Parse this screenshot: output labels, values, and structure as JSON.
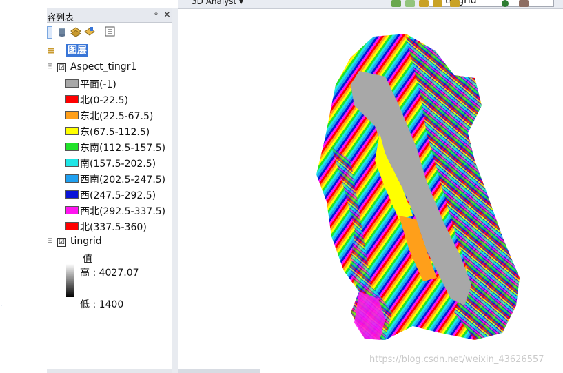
{
  "toolbar": {
    "analyst_label": "3D Analyst ▾",
    "layer_combo_value": "tingrid"
  },
  "toc": {
    "title": "容列表",
    "pin": "ᵠ",
    "close": "×",
    "root_label": "图层",
    "layers": [
      {
        "name": "Aspect_tingr1",
        "checked": "☑",
        "classes": [
          {
            "label": "平面(-1)",
            "color": "#a8a8a8"
          },
          {
            "label": "北(0-22.5)",
            "color": "#ff0000"
          },
          {
            "label": "东北(22.5-67.5)",
            "color": "#ff9f1a"
          },
          {
            "label": "东(67.5-112.5)",
            "color": "#ffff00"
          },
          {
            "label": "东南(112.5-157.5)",
            "color": "#22e22a"
          },
          {
            "label": "南(157.5-202.5)",
            "color": "#1fe5e5"
          },
          {
            "label": "西南(202.5-247.5)",
            "color": "#1fa0f0"
          },
          {
            "label": "西(247.5-292.5)",
            "color": "#0a14d8"
          },
          {
            "label": "西北(292.5-337.5)",
            "color": "#ff14f0"
          },
          {
            "label": "北(337.5-360)",
            "color": "#ff0000"
          }
        ]
      },
      {
        "name": "tingrid",
        "checked": "☑",
        "value_heading": "值",
        "high_label": "高 : 4027.07",
        "low_label": "低 : 1400"
      }
    ]
  },
  "map": {
    "watermark": "https://blog.csdn.net/weixin_43626557"
  },
  "colors": {
    "selection": "#3875d7",
    "panel_header": "#e6e9ef"
  }
}
